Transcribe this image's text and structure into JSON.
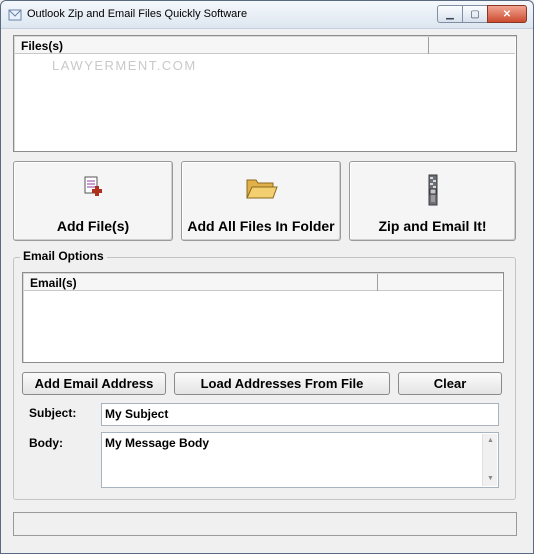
{
  "window": {
    "title": "Outlook Zip and Email Files Quickly Software",
    "minimize_glyph": "▁",
    "maximize_glyph": "▢",
    "close_glyph": "✕"
  },
  "files_list": {
    "columns": [
      "Files(s)",
      ""
    ],
    "watermark": "LAWYERMENT.COM"
  },
  "actions": {
    "add_files_label": "Add File(s)",
    "add_all_folder_label": "Add All Files In Folder",
    "zip_email_label": "Zip and Email It!"
  },
  "email_options": {
    "group_label": "Email Options",
    "columns": [
      "Email(s)",
      ""
    ],
    "add_email_label": "Add Email Address",
    "load_addresses_label": "Load Addresses From File",
    "clear_label": "Clear",
    "subject_label": "Subject:",
    "subject_value": "My Subject",
    "body_label": "Body:",
    "body_value": "My Message Body"
  },
  "statusbar": {
    "text": ""
  },
  "icons": {
    "app": "app-icon",
    "add_files": "document-add-icon",
    "folder": "folder-open-icon",
    "zip": "zip-icon"
  }
}
